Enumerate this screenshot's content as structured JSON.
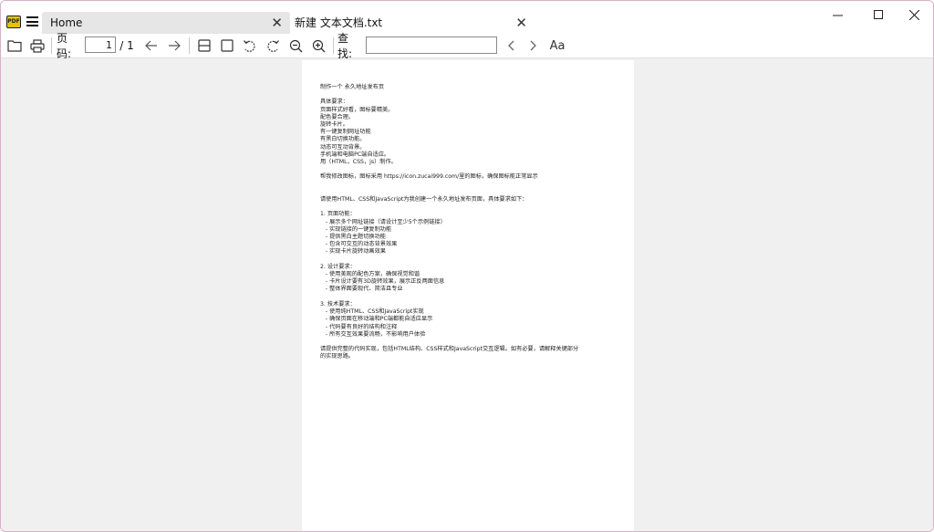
{
  "window": {
    "logo_text": "PDF",
    "tabs": [
      {
        "label": "Home",
        "active": true
      },
      {
        "label": "新建 文本文档.txt",
        "active": false
      }
    ],
    "controls": [
      "minimize-icon",
      "maximize-icon",
      "close-icon"
    ]
  },
  "toolbar": {
    "open_icon": "folder-icon",
    "print_icon": "printer-icon",
    "page_label": "页码:",
    "page_current": "1",
    "page_total": "/ 1",
    "prev_icon": "arrow-left-icon",
    "next_icon": "arrow-right-icon",
    "fit_width_icon": "fit-width-icon",
    "fit_page_icon": "fit-page-icon",
    "rotate_left_icon": "rotate-left-icon",
    "rotate_right_icon": "rotate-right-icon",
    "zoom_out_icon": "zoom-out-icon",
    "zoom_in_icon": "zoom-in-icon",
    "search_label": "查找:",
    "search_value": "",
    "search_prev_icon": "chevron-left-icon",
    "search_next_icon": "chevron-right-icon",
    "font_icon": "font-size-icon",
    "font_icon_text": "Aa"
  },
  "document": {
    "lines": [
      "制作一个 永久地址发布页",
      "",
      "具体要求：",
      "页面样式好看，图标要精美。",
      "配色要合理。",
      "旋转卡片。",
      "有一键复制网址功能",
      "有黑白切换功能。",
      "动态可互动背景。",
      "手机端和电脑PC端自适应。",
      "用（HTML，CSS，js）制作。",
      "",
      "帮我修改图标，图标采用 https://icon.zucai999.com/里的图标，确保图标能正常显示",
      "",
      "",
      "请使用HTML、CSS和JavaScript为我创建一个永久地址发布页面，具体要求如下：",
      "",
      "1. 页面功能：",
      "   - 展示多个网址链接（请设计至少5个示例链接）",
      "   - 实现链接的一键复制功能",
      "   - 提供黑白主题切换功能",
      "   - 包含可交互的动态背景效果",
      "   - 实现卡片旋转动画效果",
      "",
      "2. 设计要求：",
      "   - 使用美观的配色方案，确保视觉和谐",
      "   - 卡片设计要有3D旋转效果，展示正反两面信息",
      "   - 整体界面要现代、简洁且专业",
      "",
      "3. 技术要求：",
      "   - 使用纯HTML、CSS和JavaScript实现",
      "   - 确保页面在移动端和PC端都能自适应显示",
      "   - 代码要有良好的结构和注释",
      "   - 所有交互效果要流畅，不影响用户体验",
      "",
      "请提供完整的代码实现，包括HTML结构、CSS样式和JavaScript交互逻辑。如有必要，请解释关键部分",
      "的实现思路。"
    ]
  }
}
